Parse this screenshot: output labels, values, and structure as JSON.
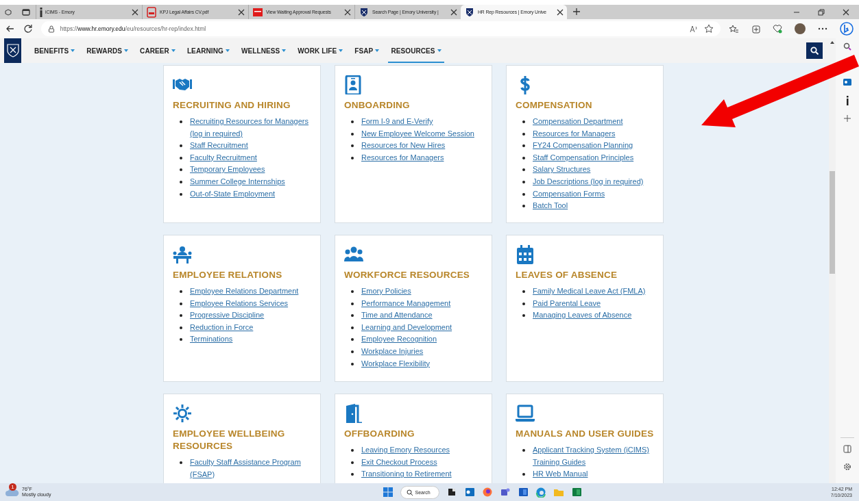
{
  "browser": {
    "tabs": [
      {
        "title": "iCIMS - Emory",
        "kind": "info",
        "selected": false
      },
      {
        "title": "KPJ Legal Affairs CV.pdf",
        "kind": "pdf",
        "selected": false
      },
      {
        "title": "View Waiting Approval Requests",
        "kind": "red",
        "selected": false
      },
      {
        "title": "Search Page | Emory University |",
        "kind": "shield",
        "selected": false
      },
      {
        "title": "HR Rep Resources | Emory Unive",
        "kind": "shield",
        "selected": true
      }
    ],
    "address": "https://**www.hr.emory.edu**/eu/resources/hr-rep/index.html"
  },
  "nav": {
    "items": [
      {
        "label": "BENEFITS",
        "selected": false
      },
      {
        "label": "REWARDS",
        "selected": false
      },
      {
        "label": "CAREER",
        "selected": false
      },
      {
        "label": "LEARNING",
        "selected": false
      },
      {
        "label": "WELLNESS",
        "selected": false
      },
      {
        "label": "WORK LIFE",
        "selected": false
      },
      {
        "label": "FSAP",
        "selected": false
      },
      {
        "label": "RESOURCES",
        "selected": true
      }
    ]
  },
  "cards": [
    {
      "kind": "handshake",
      "title": "RECRUITING AND HIRING",
      "links": [
        "Recruiting Resources for Managers (log in required)",
        "Staff Recruitment",
        "Faculty Recruitment",
        "Temporary Employees",
        "Summer College Internships",
        "Out-of-State Employment"
      ]
    },
    {
      "kind": "badge",
      "title": "ONBOARDING",
      "links": [
        "Form I-9 and E-Verify",
        "New Employee Welcome Session",
        "Resources for New Hires",
        "Resources for Managers"
      ]
    },
    {
      "kind": "dollar",
      "title": "COMPENSATION",
      "links": [
        "Compensation Department",
        "Resources for Managers",
        "FY24 Compensation Planning",
        "Staff Compensation Principles",
        "Salary Structures",
        "Job Descriptions (log in required)",
        "Compensation Forms",
        "Batch Tool"
      ]
    },
    {
      "kind": "meeting",
      "title": "EMPLOYEE RELATIONS",
      "links": [
        "Employee Relations Department",
        "Employee Relations Services",
        "Progressive Discipline",
        "Reduction in Force",
        "Terminations"
      ]
    },
    {
      "kind": "group",
      "title": "WORKFORCE RESOURCES",
      "links": [
        "Emory Policies",
        "Performance Management",
        "Time and Attendance",
        "Learning and Development",
        "Employee Recognition",
        "Workplace Injuries",
        "Workplace Flexibility"
      ]
    },
    {
      "kind": "calendar",
      "title": "LEAVES OF ABSENCE",
      "links": [
        "Family Medical Leave Act (FMLA)",
        "Paid Parental Leave",
        "Managing Leaves of Absence"
      ]
    },
    {
      "kind": "sun",
      "title": "EMPLOYEE WELLBEING RESOURCES",
      "links": [
        "Faculty Staff Assistance Program (FSAP)"
      ]
    },
    {
      "kind": "door",
      "title": "OFFBOARDING",
      "links": [
        "Leaving Emory Resources",
        "Exit Checkout Process",
        "Transitioning to Retirement"
      ]
    },
    {
      "kind": "laptop",
      "title": "MANUALS AND USER GUIDES",
      "links": [
        "Applicant Tracking System (iCIMS) Training Guides",
        "HR Web Manual"
      ]
    }
  ],
  "taskbar": {
    "weather": {
      "badge": "1",
      "temperature": "76°F",
      "condition": "Mostly cloudy"
    },
    "search": "Search",
    "time": "12:42 PM",
    "date": "7/10/2023"
  }
}
